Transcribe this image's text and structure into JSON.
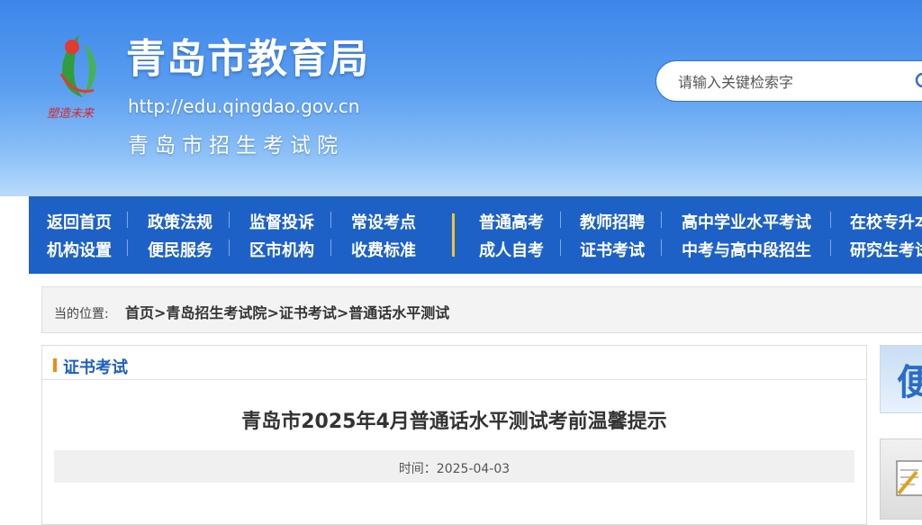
{
  "header": {
    "site_title": "青岛市教育局",
    "site_url": "http://edu.qingdao.gov.cn",
    "subtitle": "青岛市招生考试院",
    "logo_text": "塑造未来",
    "search_placeholder": "请输入关键检索字"
  },
  "nav": {
    "row1": [
      "返回首页",
      "政策法规",
      "监督投诉",
      "常设考点",
      "普通高考",
      "教师招聘",
      "高中学业水平考试",
      "在校专升本"
    ],
    "row2": [
      "机构设置",
      "便民服务",
      "区市机构",
      "收费标准",
      "成人自考",
      "证书考试",
      "中考与高中段招生",
      "研究生考试"
    ]
  },
  "breadcrumb": {
    "label": "当的位置:",
    "items": [
      "首页",
      "青岛招生考试院",
      "证书考试",
      "普通话水平测试"
    ],
    "separator": ">"
  },
  "section": {
    "title": "证书考试"
  },
  "article": {
    "title": "青岛市2025年4月普通话水平测试考前温馨提示",
    "meta": "时间：2025-04-03"
  },
  "sidebar": {
    "banner1_glyph": "便"
  },
  "colors": {
    "nav_bg": "#1e61c6",
    "accent_orange": "#f08a16",
    "divider_yellow": "#f2c431",
    "section_title": "#1e5fbf"
  },
  "icons": [
    "logo-emblem-icon",
    "search-icon",
    "document-pencil-icon"
  ]
}
